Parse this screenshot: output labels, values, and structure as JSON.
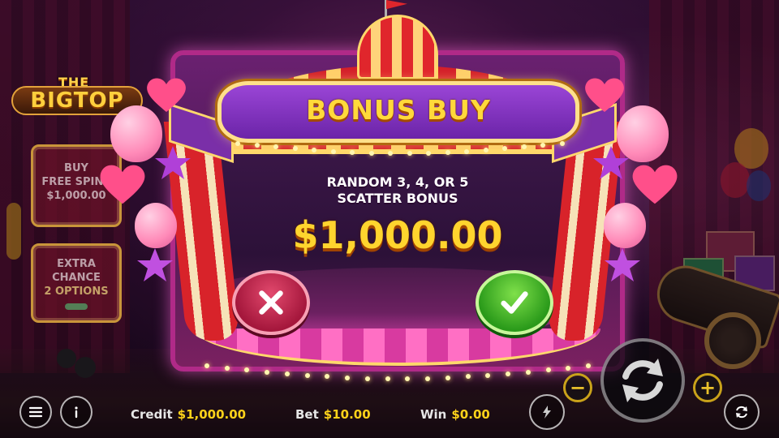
{
  "logo": {
    "the": "THE",
    "name": "BIGTOP"
  },
  "side_panels": {
    "buy": {
      "line1": "BUY",
      "line2": "FREE SPINS",
      "line3": "$1,000.00"
    },
    "extra": {
      "line1": "EXTRA",
      "line2": "CHANCE",
      "line3": "2 OPTIONS"
    }
  },
  "dialog": {
    "title": "BONUS BUY",
    "offer_line1": "RANDOM 3, 4, OR 5",
    "offer_line2": "SCATTER BONUS",
    "price": "$1,000.00",
    "cancel_icon": "close-icon",
    "confirm_icon": "checkmark-icon"
  },
  "bottom_bar": {
    "credit_label": "Credit",
    "credit_value": "$1,000.00",
    "bet_label": "Bet",
    "bet_value": "$10.00",
    "win_label": "Win",
    "win_value": "$0.00",
    "menu_icon": "menu-icon",
    "info_icon": "info-icon",
    "turbo_icon": "lightning-icon",
    "autoplay_icon": "autoplay-icon",
    "spin_icon": "spin-icon",
    "minus_label": "−",
    "plus_label": "+"
  },
  "colors": {
    "gold": "#ffd42e",
    "banner_purple": "#7a2fa8",
    "cancel_red": "#a5173c",
    "confirm_green": "#2a9a1a"
  }
}
